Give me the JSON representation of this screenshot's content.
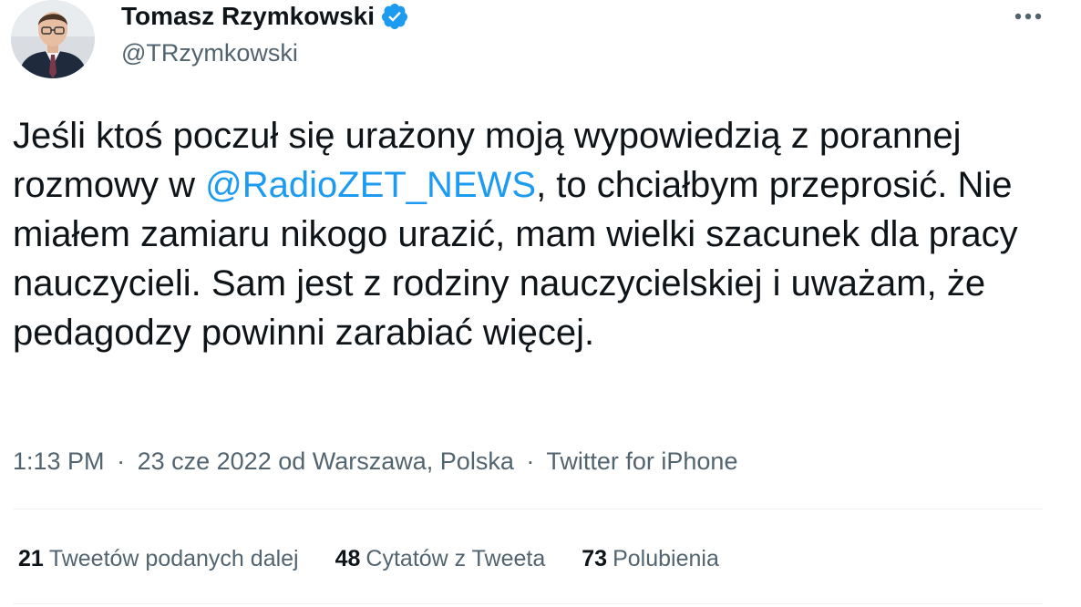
{
  "author": {
    "name": "Tomasz Rzymkowski",
    "handle": "@TRzymkowski",
    "verified": true,
    "accent_color": "#1d9bf0"
  },
  "tweet": {
    "text_before_mention": "Jeśli ktoś poczuł się urażony moją wypowiedzią z porannej rozmowy w ",
    "mention": "@RadioZET_NEWS",
    "text_after_mention": ", to chciałbym przeprosić. Nie miałem zamiaru nikogo urazić, mam wielki szacunek dla pracy nauczycieli. Sam jest z rodziny nauczycielskiej i uważam, że pedagodzy powinni zarabiać więcej."
  },
  "meta": {
    "time": "1:13 PM",
    "separator": "·",
    "date": "23 cze 2022",
    "location": "od Warszawa, Polska",
    "source": "Twitter for iPhone"
  },
  "stats": {
    "retweets_count": "21",
    "retweets_label": "Tweetów podanych dalej",
    "quotes_count": "48",
    "quotes_label": "Cytatów z Tweeta",
    "likes_count": "73",
    "likes_label": "Polubienia"
  },
  "icons": {
    "verified": "verified-badge-icon",
    "more": "more-horizontal-icon"
  }
}
